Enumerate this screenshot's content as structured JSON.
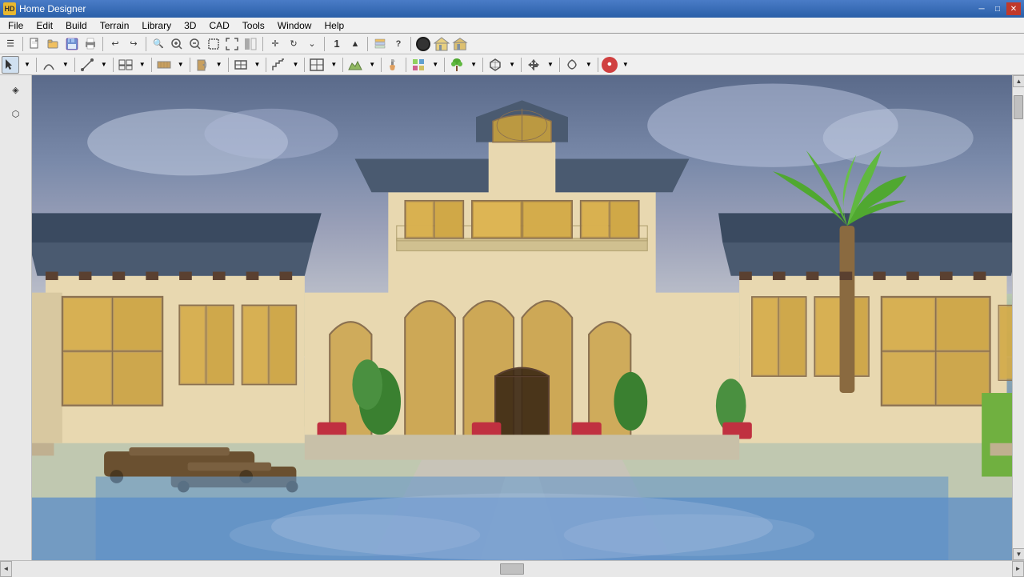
{
  "app": {
    "title": "Home Designer",
    "icon_label": "HD"
  },
  "window_controls": {
    "minimize": "─",
    "maximize": "□",
    "close": "✕"
  },
  "menu": {
    "items": [
      "File",
      "Edit",
      "Build",
      "Terrain",
      "Library",
      "3D",
      "CAD",
      "Tools",
      "Window",
      "Help"
    ]
  },
  "toolbar1": {
    "buttons": [
      {
        "name": "app-menu-btn",
        "icon": "≡"
      },
      {
        "name": "new-btn",
        "icon": "📄"
      },
      {
        "name": "open-btn",
        "icon": "📂"
      },
      {
        "name": "save-btn",
        "icon": "💾"
      },
      {
        "name": "print-btn",
        "icon": "🖨"
      },
      {
        "name": "undo-btn",
        "icon": "↩"
      },
      {
        "name": "redo-btn",
        "icon": "↪"
      },
      {
        "name": "search-btn",
        "icon": "🔍"
      },
      {
        "name": "zoom-in-btn",
        "icon": "🔍+"
      },
      {
        "name": "zoom-out-btn",
        "icon": "🔍-"
      },
      {
        "name": "select-btn",
        "icon": "⬜"
      },
      {
        "name": "fullscreen-btn",
        "icon": "⤢"
      },
      {
        "name": "fit-btn",
        "icon": "⤡"
      },
      {
        "name": "pan-btn",
        "icon": "✛"
      },
      {
        "name": "orbit-btn",
        "icon": "↻"
      },
      {
        "name": "walk-btn",
        "icon": "⌄"
      },
      {
        "name": "num-field",
        "icon": "1"
      },
      {
        "name": "up-btn",
        "icon": "▲"
      },
      {
        "name": "down-btn",
        "icon": "▼"
      },
      {
        "name": "layers-btn",
        "icon": "📚"
      },
      {
        "name": "help-btn",
        "icon": "?"
      },
      {
        "name": "hat-btn",
        "icon": "🎩"
      },
      {
        "name": "house-btn",
        "icon": "🏠"
      },
      {
        "name": "door-btn",
        "icon": "🚪"
      }
    ]
  },
  "toolbar2": {
    "dropdowns": [
      {
        "name": "select-tool",
        "icon": "↖"
      },
      {
        "name": "arc-tool",
        "icon": "⌒"
      },
      {
        "name": "line-tool",
        "icon": "─"
      },
      {
        "name": "view-tool",
        "icon": "👁"
      },
      {
        "name": "wall-tool",
        "icon": "▣"
      },
      {
        "name": "door-tool",
        "icon": "🚪"
      },
      {
        "name": "window-tool",
        "icon": "⊞"
      },
      {
        "name": "stair-tool",
        "icon": "⊓"
      },
      {
        "name": "room-tool",
        "icon": "⊡"
      },
      {
        "name": "terrain-tool",
        "icon": "⛰"
      },
      {
        "name": "paint-tool",
        "icon": "🖊"
      },
      {
        "name": "texture-tool",
        "icon": "▦"
      },
      {
        "name": "plant-tool",
        "icon": "🌿"
      },
      {
        "name": "object-tool",
        "icon": "◈"
      },
      {
        "name": "move-tool",
        "icon": "↕"
      },
      {
        "name": "transform-tool",
        "icon": "↻"
      },
      {
        "name": "record-btn",
        "icon": "⏺"
      }
    ]
  },
  "left_panel": {
    "buttons": [
      {
        "name": "panel-btn-1",
        "icon": "◈"
      },
      {
        "name": "panel-btn-2",
        "icon": "⬡"
      }
    ]
  },
  "canvas": {
    "description": "3D rendering of Mediterranean-style luxury house with pool"
  },
  "status_bar": {
    "left_arrow": "◄",
    "right_arrow": "►",
    "up_arrow": "▲",
    "down_arrow": "▼"
  }
}
